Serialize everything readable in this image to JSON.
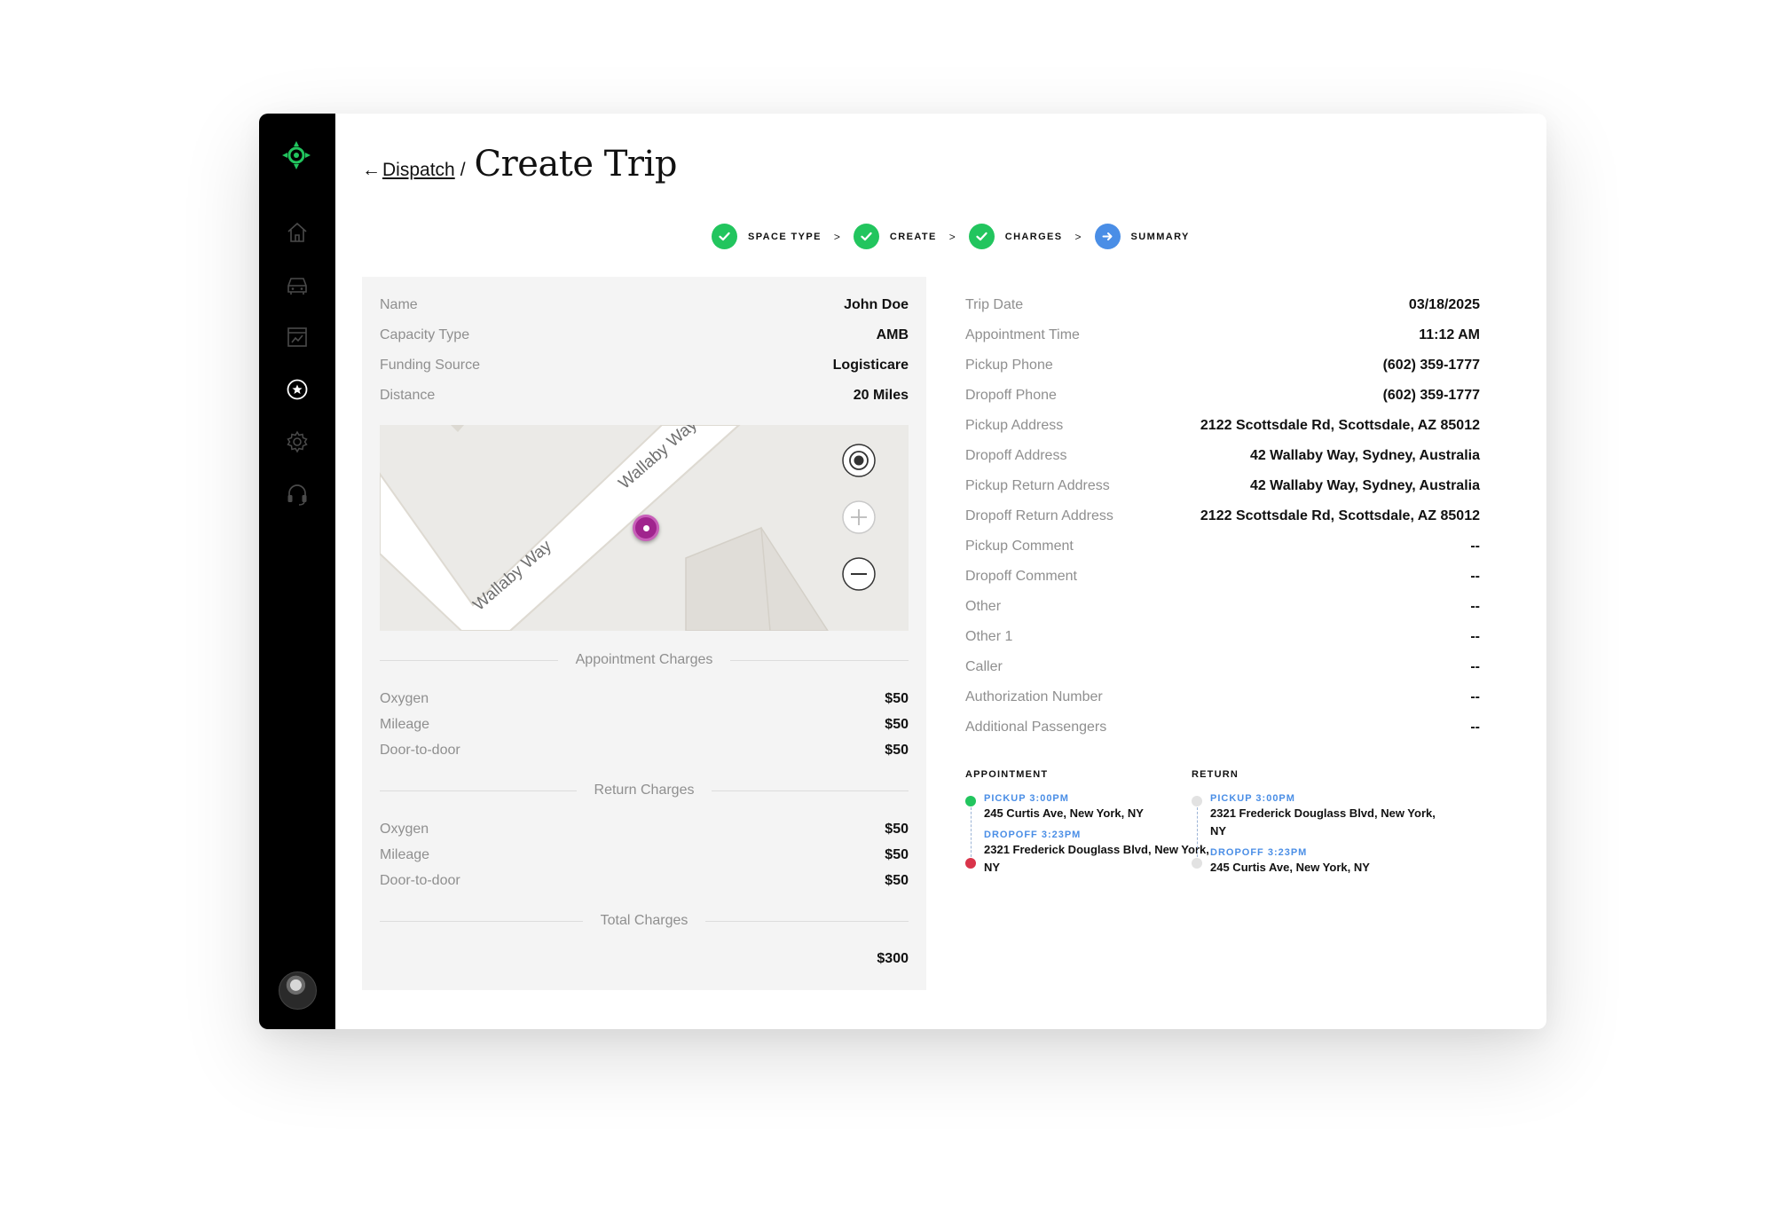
{
  "breadcrumb": {
    "back_arrow": "←",
    "back_label": "Dispatch",
    "separator": "/",
    "title": "Create Trip"
  },
  "sidebar": {
    "items": [
      {
        "icon": "home-icon"
      },
      {
        "icon": "car-icon"
      },
      {
        "icon": "report-icon"
      },
      {
        "icon": "star-circle-icon"
      },
      {
        "icon": "gear-icon"
      },
      {
        "icon": "headset-icon"
      }
    ]
  },
  "stepper": {
    "steps": [
      {
        "label": "SPACE TYPE",
        "state": "complete"
      },
      {
        "label": "CREATE",
        "state": "complete"
      },
      {
        "label": "CHARGES",
        "state": "complete"
      },
      {
        "label": "SUMMARY",
        "state": "current"
      }
    ],
    "separator": ">",
    "colors": {
      "complete": "#22c55e",
      "current": "#4a8ee6"
    }
  },
  "trip": {
    "name_label": "Name",
    "name": "John Doe",
    "capacity_label": "Capacity Type",
    "capacity": "AMB",
    "funding_label": "Funding Source",
    "funding": "Logisticare",
    "distance_label": "Distance",
    "distance": "20 Miles"
  },
  "map": {
    "street_1": "Wallaby Way",
    "street_2": "Wallaby Way"
  },
  "charges": {
    "appointment_title": "Appointment Charges",
    "appointment": [
      {
        "label": "Oxygen",
        "value": "$50"
      },
      {
        "label": "Mileage",
        "value": "$50"
      },
      {
        "label": "Door-to-door",
        "value": "$50"
      }
    ],
    "return_title": "Return Charges",
    "return": [
      {
        "label": "Oxygen",
        "value": "$50"
      },
      {
        "label": "Mileage",
        "value": "$50"
      },
      {
        "label": "Door-to-door",
        "value": "$50"
      }
    ],
    "total_title": "Total Charges",
    "total": "$300"
  },
  "details": [
    {
      "label": "Trip Date",
      "value": "03/18/2025"
    },
    {
      "label": "Appointment Time",
      "value": "11:12 AM"
    },
    {
      "label": "Pickup Phone",
      "value": "(602) 359-1777"
    },
    {
      "label": "Dropoff Phone",
      "value": "(602) 359-1777"
    },
    {
      "label": "Pickup Address",
      "value": "2122 Scottsdale Rd, Scottsdale, AZ 85012"
    },
    {
      "label": "Dropoff Address",
      "value": "42 Wallaby Way, Sydney, Australia"
    },
    {
      "label": "Pickup Return Address",
      "value": "42 Wallaby Way, Sydney, Australia"
    },
    {
      "label": "Dropoff Return Address",
      "value": "2122 Scottsdale Rd, Scottsdale, AZ 85012"
    },
    {
      "label": "Pickup Comment",
      "value": "--"
    },
    {
      "label": "Dropoff Comment",
      "value": "--"
    },
    {
      "label": "Other",
      "value": "--"
    },
    {
      "label": "Other 1",
      "value": "--"
    },
    {
      "label": "Caller",
      "value": "--"
    },
    {
      "label": "Authorization Number",
      "value": "--"
    },
    {
      "label": "Additional Passengers",
      "value": "--"
    }
  ],
  "route": {
    "appointment": {
      "title": "APPOINTMENT",
      "pickup_label": "PICKUP 3:00PM",
      "pickup_addr": "245 Curtis Ave, New York, NY",
      "dropoff_label": "DROPOFF 3:23PM",
      "dropoff_addr_1": "2321 Frederick Douglass Blvd, New York,",
      "dropoff_addr_2": "NY"
    },
    "return": {
      "title": "RETURN",
      "pickup_label": "PICKUP 3:00PM",
      "pickup_addr_1": "2321 Frederick Douglass Blvd, New York,",
      "pickup_addr_2": "NY",
      "dropoff_label": "DROPOFF 3:23PM",
      "dropoff_addr": "245 Curtis Ave, New York, NY"
    },
    "colors": {
      "start": "#22c55e",
      "end": "#d9344a",
      "inactive": "#e2e2e2"
    }
  }
}
